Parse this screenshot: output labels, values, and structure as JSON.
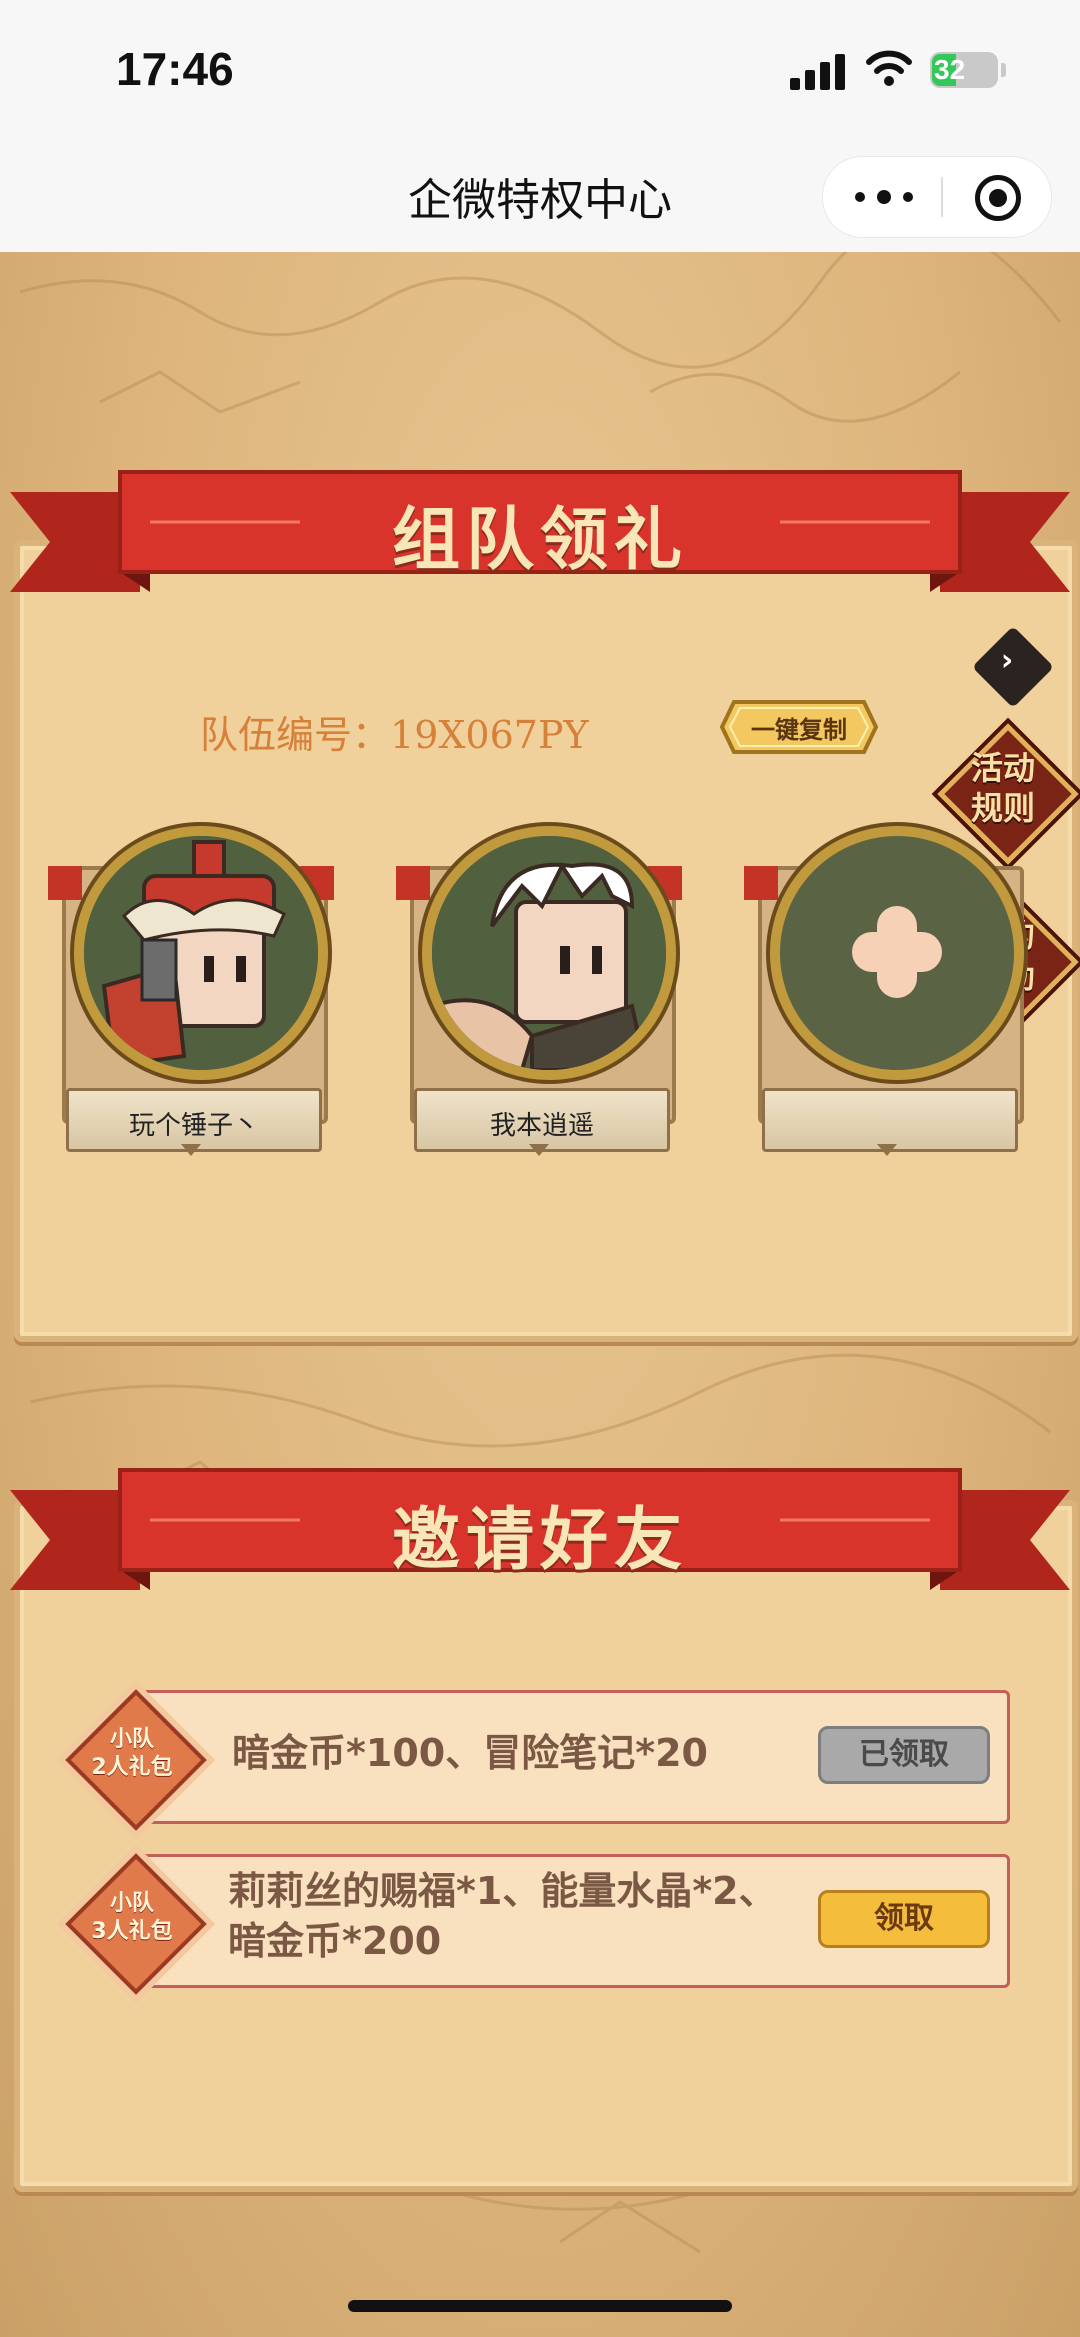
{
  "status_bar": {
    "time": "17:46",
    "battery": "32"
  },
  "nav": {
    "title": "企微特权中心"
  },
  "team_section": {
    "title": "组队领礼",
    "team_label": "队伍编号：",
    "team_id": "19X067PY",
    "copy_button": "一键复制",
    "members": [
      {
        "name": "玩个锤子丶"
      },
      {
        "name": "我本逍遥"
      },
      {
        "name": ""
      }
    ],
    "side_buttons": {
      "rules": "活动\n规则",
      "rewards": "我的\n奖励"
    }
  },
  "invite_section": {
    "title": "邀请好友",
    "rewards": [
      {
        "badge": "小队\n2人礼包",
        "text": "暗金币*100、冒险笔记*20",
        "button": "已领取",
        "status": "claimed"
      },
      {
        "badge": "小队\n3人礼包",
        "text": "莉莉丝的赐福*1、能量水晶*2、\n暗金币*200",
        "button": "领取",
        "status": "available"
      }
    ]
  },
  "colors": {
    "ribbon": "#d8342c",
    "panel": "#f0d09b",
    "claim_button": "#f4bd3c",
    "claimed_button": "#a9a9a9"
  }
}
